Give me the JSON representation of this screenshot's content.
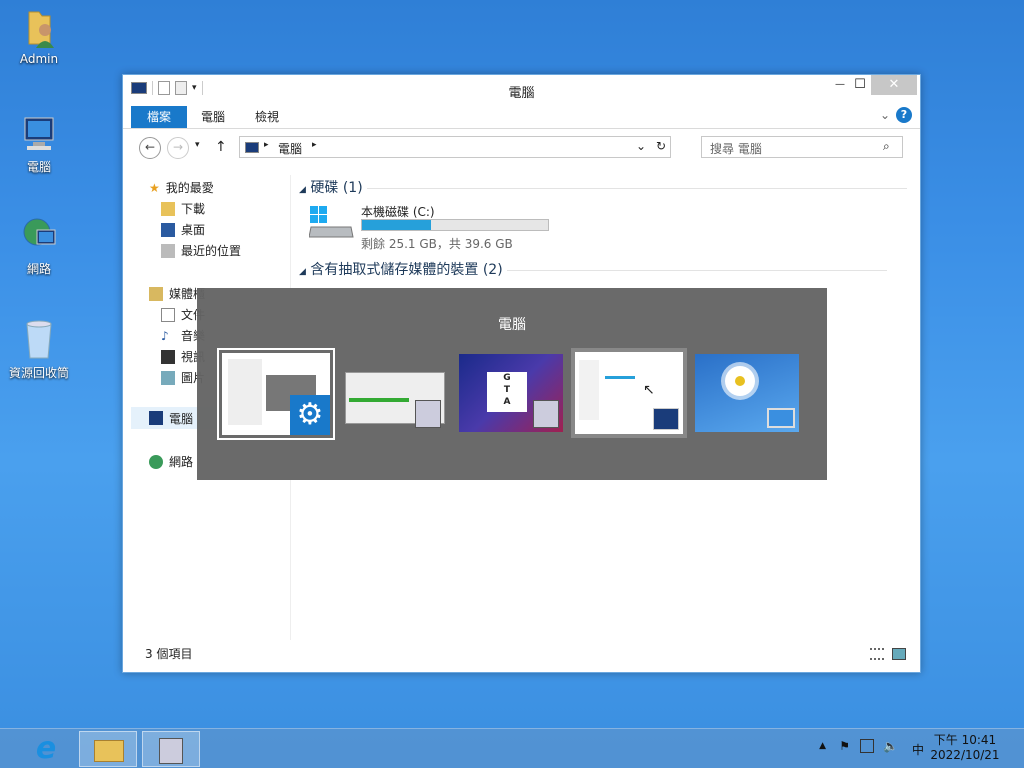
{
  "desktop": {
    "icons": [
      {
        "label": "Admin"
      },
      {
        "label": "電腦"
      },
      {
        "label": "網路"
      },
      {
        "label": "資源回收筒"
      }
    ]
  },
  "window": {
    "title": "電腦",
    "controls": {
      "minimize": "—",
      "maximize": "☐",
      "close": "✕"
    }
  },
  "ribbon": {
    "tabs": [
      "檔案",
      "電腦",
      "檢視"
    ]
  },
  "address": {
    "path": "電腦",
    "search_placeholder": "搜尋 電腦"
  },
  "sidebar": {
    "favorites": "我的最愛",
    "downloads": "下載",
    "desktop": "桌面",
    "recent": "最近的位置",
    "libraries": "媒體櫃",
    "documents": "文件",
    "music": "音樂",
    "videos": "視訊",
    "pictures": "圖片",
    "computer": "電腦",
    "network": "網路"
  },
  "main": {
    "section_hdd": "硬碟 (1)",
    "drive_name": "本機磁碟 (C:)",
    "drive_usage": 0.37,
    "drive_info": "剩餘 25.1 GB，共 39.6 GB",
    "section_removable": "含有抽取式儲存媒體的裝置 (2)"
  },
  "status": {
    "items": "3 個項目"
  },
  "switcher": {
    "title": "電腦",
    "thumbs": [
      "control-panel",
      "installer-progress",
      "gta-vice-city",
      "explorer-computer",
      "desktop-daisy"
    ]
  },
  "tray": {
    "time": "下午 10:41",
    "date": "2022/10/21",
    "ime": "中"
  },
  "colors": {
    "accent": "#1979ca",
    "usage_bar": "#26a0da"
  }
}
